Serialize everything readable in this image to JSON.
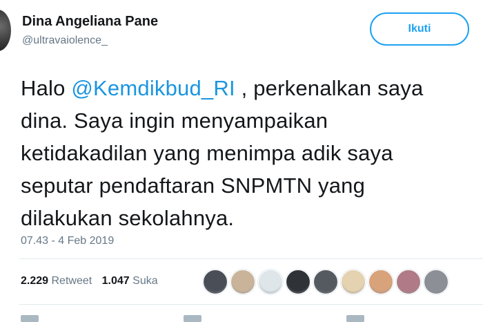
{
  "user": {
    "name": "Dina Angeliana Pane",
    "handle": "@ultravaiolence_"
  },
  "follow_button": {
    "label": "Ikuti"
  },
  "tweet": {
    "lines": [
      {
        "pre": "Halo ",
        "mention": "@Kemdikbud_RI",
        "post": " , perkenalkan saya"
      },
      {
        "text": "dina. Saya ingin menyampaikan"
      },
      {
        "text": "ketidakadilan yang menimpa adik saya"
      },
      {
        "text": "seputar pendaftaran SNPMTN yang"
      },
      {
        "text": "dilakukan sekolahnya."
      }
    ],
    "timestamp": "07.43 - 4 Feb 2019"
  },
  "stats": {
    "retweets": "2.229",
    "retweets_label": "Retweet",
    "likes": "1.047",
    "likes_label": "Suka"
  },
  "likers": [
    {
      "color": "#4a4f57"
    },
    {
      "color": "#c9b49a"
    },
    {
      "color": "#dfe6ea"
    },
    {
      "color": "#2f3338"
    },
    {
      "color": "#555a60"
    },
    {
      "color": "#e4d2b0"
    },
    {
      "color": "#d8a27a"
    },
    {
      "color": "#b07b86"
    },
    {
      "color": "#8c8f96"
    }
  ],
  "colors": {
    "accent": "#1da1f2",
    "mention": "#1b95e0",
    "muted": "#657786"
  }
}
